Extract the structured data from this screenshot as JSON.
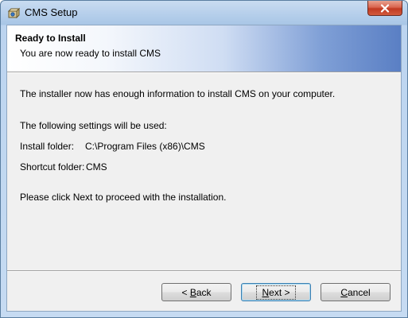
{
  "window": {
    "title": "CMS Setup"
  },
  "banner": {
    "title": "Ready to Install",
    "subtitle": "You are now ready to install CMS"
  },
  "body": {
    "intro": "The installer now has enough information to install CMS on your computer.",
    "settings_heading": "The following settings will be used:",
    "install_folder_label": "Install folder:",
    "install_folder_value": "C:\\Program Files (x86)\\CMS",
    "shortcut_folder_label": "Shortcut folder:",
    "shortcut_folder_value": "CMS",
    "instruction": "Please click Next to proceed with the installation."
  },
  "buttons": {
    "back": {
      "mnemonic": "B",
      "rest": "ack",
      "prefix": "< "
    },
    "next": {
      "mnemonic": "N",
      "rest": "ext >"
    },
    "cancel": {
      "mnemonic": "C",
      "rest": "ancel"
    }
  },
  "colors": {
    "close_button": "#c13a22",
    "banner_accent": "#5a7fc4",
    "default_button_border": "#3c7fb1"
  },
  "icons": {
    "app": "installer-box-icon",
    "close": "close-icon"
  }
}
